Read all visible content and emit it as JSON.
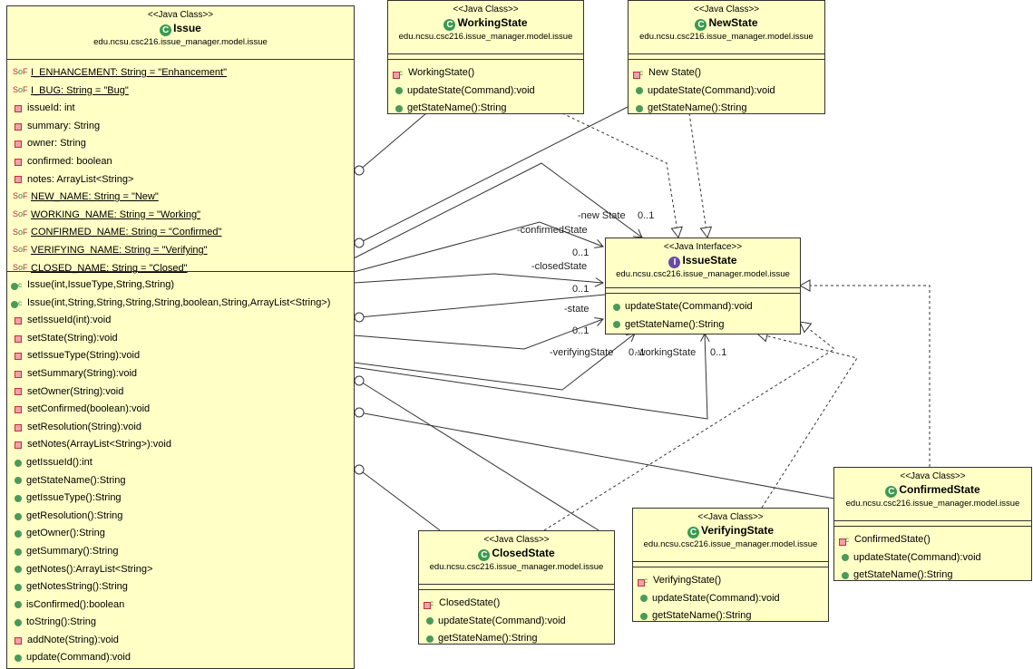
{
  "issue": {
    "stereotype": "<<Java Class>>",
    "name": "Issue",
    "package": "edu.ncsu.csc216.issue_manager.model.issue",
    "attributes": [
      {
        "kind": "static-final",
        "text": "I_ENHANCEMENT: String = \"Enhancement\""
      },
      {
        "kind": "static-final",
        "text": "I_BUG: String = \"Bug\""
      },
      {
        "kind": "private",
        "text": "issueId: int"
      },
      {
        "kind": "private",
        "text": "summary: String"
      },
      {
        "kind": "private",
        "text": "owner: String"
      },
      {
        "kind": "private",
        "text": "confirmed: boolean"
      },
      {
        "kind": "private",
        "text": "notes: ArrayList<String>"
      },
      {
        "kind": "static-final",
        "text": "NEW_NAME: String = \"New\""
      },
      {
        "kind": "static-final",
        "text": "WORKING_NAME: String = \"Working\""
      },
      {
        "kind": "static-final",
        "text": "CONFIRMED_NAME: String = \"Confirmed\""
      },
      {
        "kind": "static-final",
        "text": "VERIFYING_NAME: String = \"Verifying\""
      },
      {
        "kind": "static-final",
        "text": "CLOSED_NAME: String = \"Closed\""
      }
    ],
    "methods": [
      {
        "kind": "ctor-public",
        "text": "Issue(int,IssueType,String,String)"
      },
      {
        "kind": "ctor-public",
        "text": "Issue(int,String,String,String,String,boolean,String,ArrayList<String>)"
      },
      {
        "kind": "private",
        "text": "setIssueId(int):void"
      },
      {
        "kind": "private",
        "text": "setState(String):void"
      },
      {
        "kind": "private",
        "text": "setIssueType(String):void"
      },
      {
        "kind": "private",
        "text": "setSummary(String):void"
      },
      {
        "kind": "private",
        "text": "setOwner(String):void"
      },
      {
        "kind": "private",
        "text": "setConfirmed(boolean):void"
      },
      {
        "kind": "private",
        "text": "setResolution(String):void"
      },
      {
        "kind": "private",
        "text": "setNotes(ArrayList<String>):void"
      },
      {
        "kind": "public",
        "text": "getIssueId():int"
      },
      {
        "kind": "public",
        "text": "getStateName():String"
      },
      {
        "kind": "public",
        "text": "getIssueType():String"
      },
      {
        "kind": "public",
        "text": "getResolution():String"
      },
      {
        "kind": "public",
        "text": "getOwner():String"
      },
      {
        "kind": "public",
        "text": "getSummary():String"
      },
      {
        "kind": "public",
        "text": "getNotes():ArrayList<String>"
      },
      {
        "kind": "public",
        "text": "getNotesString():String"
      },
      {
        "kind": "public",
        "text": "isConfirmed():boolean"
      },
      {
        "kind": "public",
        "text": "toString():String"
      },
      {
        "kind": "private",
        "text": "addNote(String):void"
      },
      {
        "kind": "public",
        "text": "update(Command):void"
      }
    ]
  },
  "states": [
    {
      "id": "working",
      "stereotype": "<<Java Class>>",
      "name": "WorkingState",
      "package": "edu.ncsu.csc216.issue_manager.model.issue",
      "methods": [
        {
          "kind": "ctor-private",
          "text": "WorkingState()"
        },
        {
          "kind": "public",
          "text": "updateState(Command):void"
        },
        {
          "kind": "public",
          "text": "getStateName():String"
        }
      ]
    },
    {
      "id": "new",
      "stereotype": "<<Java Class>>",
      "name": "NewState",
      "package": "edu.ncsu.csc216.issue_manager.model.issue",
      "methods": [
        {
          "kind": "ctor-private",
          "text": "New State()"
        },
        {
          "kind": "public",
          "text": "updateState(Command):void"
        },
        {
          "kind": "public",
          "text": "getStateName():String"
        }
      ]
    },
    {
      "id": "confirmed",
      "stereotype": "<<Java Class>>",
      "name": "ConfirmedState",
      "package": "edu.ncsu.csc216.issue_manager.model.issue",
      "methods": [
        {
          "kind": "ctor-private",
          "text": "ConfirmedState()"
        },
        {
          "kind": "public",
          "text": "updateState(Command):void"
        },
        {
          "kind": "public",
          "text": "getStateName():String"
        }
      ]
    },
    {
      "id": "verifying",
      "stereotype": "<<Java Class>>",
      "name": "VerifyingState",
      "package": "edu.ncsu.csc216.issue_manager.model.issue",
      "methods": [
        {
          "kind": "ctor-private",
          "text": "VerifyingState()"
        },
        {
          "kind": "public",
          "text": "updateState(Command):void"
        },
        {
          "kind": "public",
          "text": "getStateName():String"
        }
      ]
    },
    {
      "id": "closed",
      "stereotype": "<<Java Class>>",
      "name": "ClosedState",
      "package": "edu.ncsu.csc216.issue_manager.model.issue",
      "methods": [
        {
          "kind": "ctor-private",
          "text": "ClosedState()"
        },
        {
          "kind": "public",
          "text": "updateState(Command):void"
        },
        {
          "kind": "public",
          "text": "getStateName():String"
        }
      ]
    }
  ],
  "iface": {
    "stereotype": "<<Java Interface>>",
    "name": "IssueState",
    "package": "edu.ncsu.csc216.issue_manager.model.issue",
    "methods": [
      {
        "kind": "public",
        "text": "updateState(Command):void"
      },
      {
        "kind": "public",
        "text": "getStateName():String"
      }
    ]
  },
  "assoc_labels": [
    {
      "id": "new",
      "role": "-new State",
      "mult": "0..1"
    },
    {
      "id": "confirmed",
      "role": "-confirmedState",
      "mult": "0..1"
    },
    {
      "id": "closed",
      "role": "-closedState",
      "mult": "0..1"
    },
    {
      "id": "state",
      "role": "-state",
      "mult": "0..1"
    },
    {
      "id": "verifying",
      "role": "-verifyingState",
      "mult": "0..1"
    },
    {
      "id": "working",
      "role": "-workingState",
      "mult": "0..1"
    }
  ]
}
